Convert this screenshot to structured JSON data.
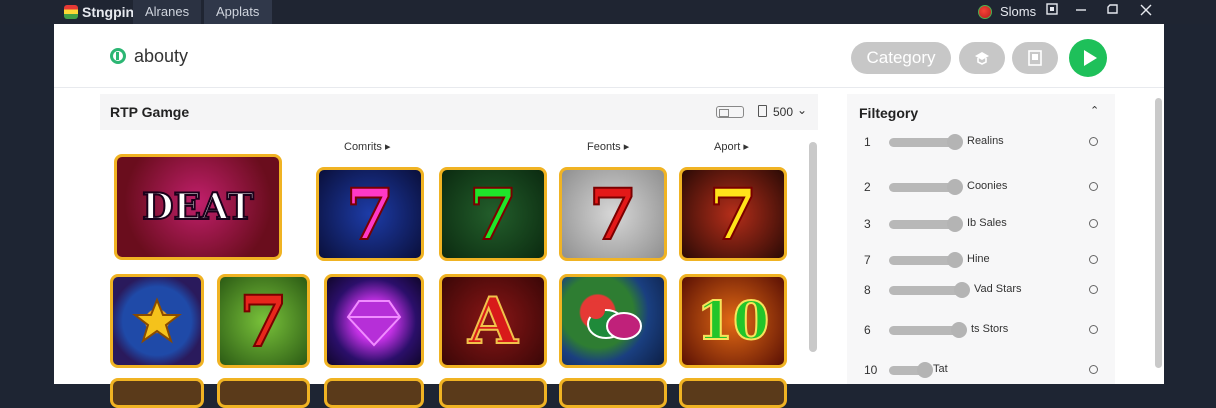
{
  "titlebar": {
    "app_name": "Stngpin",
    "tabs": [
      "Alranes",
      "Applats"
    ],
    "status": "Sloms",
    "window_buttons": [
      "restore",
      "minimize",
      "maximize",
      "close"
    ]
  },
  "header": {
    "brand": "abouty",
    "category_button": "Category",
    "icon_buttons": [
      "certificate-icon",
      "document-icon"
    ],
    "play_button": "play-icon"
  },
  "games_panel": {
    "title": "RTP Gamge",
    "count": "500",
    "columns": [
      "Comrits",
      "Feonts",
      "Aport"
    ]
  },
  "tiles": [
    {
      "kind": "deat",
      "text": "DEAT"
    },
    {
      "kind": "seven",
      "text": "7"
    },
    {
      "kind": "seven",
      "text": "7"
    },
    {
      "kind": "seven",
      "text": "7"
    },
    {
      "kind": "seven",
      "text": "7"
    },
    {
      "kind": "star",
      "text": ""
    },
    {
      "kind": "seven",
      "text": "7"
    },
    {
      "kind": "gem",
      "text": ""
    },
    {
      "kind": "letter",
      "text": "A"
    },
    {
      "kind": "chips",
      "text": ""
    },
    {
      "kind": "ten",
      "text": "10"
    }
  ],
  "filter_panel": {
    "title": "Filtegory",
    "rows": [
      {
        "num": "1",
        "label": "Realins"
      },
      {
        "num": "2",
        "label": "Coonies"
      },
      {
        "num": "3",
        "label": "Ib Sales"
      },
      {
        "num": "7",
        "label": "Hine"
      },
      {
        "num": "8",
        "label": "Vad Stars"
      },
      {
        "num": "6",
        "label": "ts Stors"
      },
      {
        "num": "10",
        "label": "Tat"
      }
    ]
  },
  "colors": {
    "accent_green": "#1ec05a",
    "tile_border": "#f0b323",
    "titlebar": "#1f2532"
  }
}
